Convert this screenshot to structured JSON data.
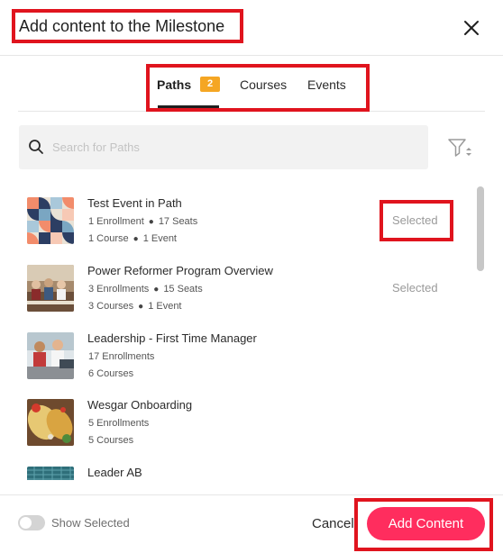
{
  "modal": {
    "title": "Add content to the Milestone",
    "close_icon": "close-icon"
  },
  "tabs": [
    {
      "label": "Paths",
      "badge": "2",
      "active": true
    },
    {
      "label": "Courses",
      "active": false
    },
    {
      "label": "Events",
      "active": false
    }
  ],
  "search": {
    "placeholder": "Search for Paths",
    "value": "",
    "icon": "search-icon",
    "filter_icon": "filter-icon"
  },
  "items": [
    {
      "title": "Test Event in Path",
      "meta1a": "1 Enrollment",
      "meta1b": "17 Seats",
      "meta2a": "1 Course",
      "meta2b": "1 Event",
      "status": "Selected",
      "thumb": "geometric-pattern"
    },
    {
      "title": "Power Reformer Program Overview",
      "meta1a": "3 Enrollments",
      "meta1b": "15 Seats",
      "meta2a": "3 Courses",
      "meta2b": "1 Event",
      "status": "Selected",
      "thumb": "meeting-photo"
    },
    {
      "title": "Leadership - First Time Manager",
      "meta1a": "17 Enrollments",
      "meta2a": "6 Courses",
      "status": "",
      "thumb": "team-photo"
    },
    {
      "title": "Wesgar Onboarding",
      "meta1a": "5 Enrollments",
      "meta2a": "5 Courses",
      "status": "",
      "thumb": "food-photo"
    },
    {
      "title": "Leader AB",
      "thumb": "building-photo"
    }
  ],
  "footer": {
    "show_selected_label": "Show Selected",
    "show_selected_on": false,
    "cancel_label": "Cancel",
    "add_label": "Add Content"
  },
  "colors": {
    "primary_button": "#ff2d5e",
    "badge": "#f5a623",
    "highlight": "#e0141e",
    "selected_text": "#9a9a9a"
  }
}
